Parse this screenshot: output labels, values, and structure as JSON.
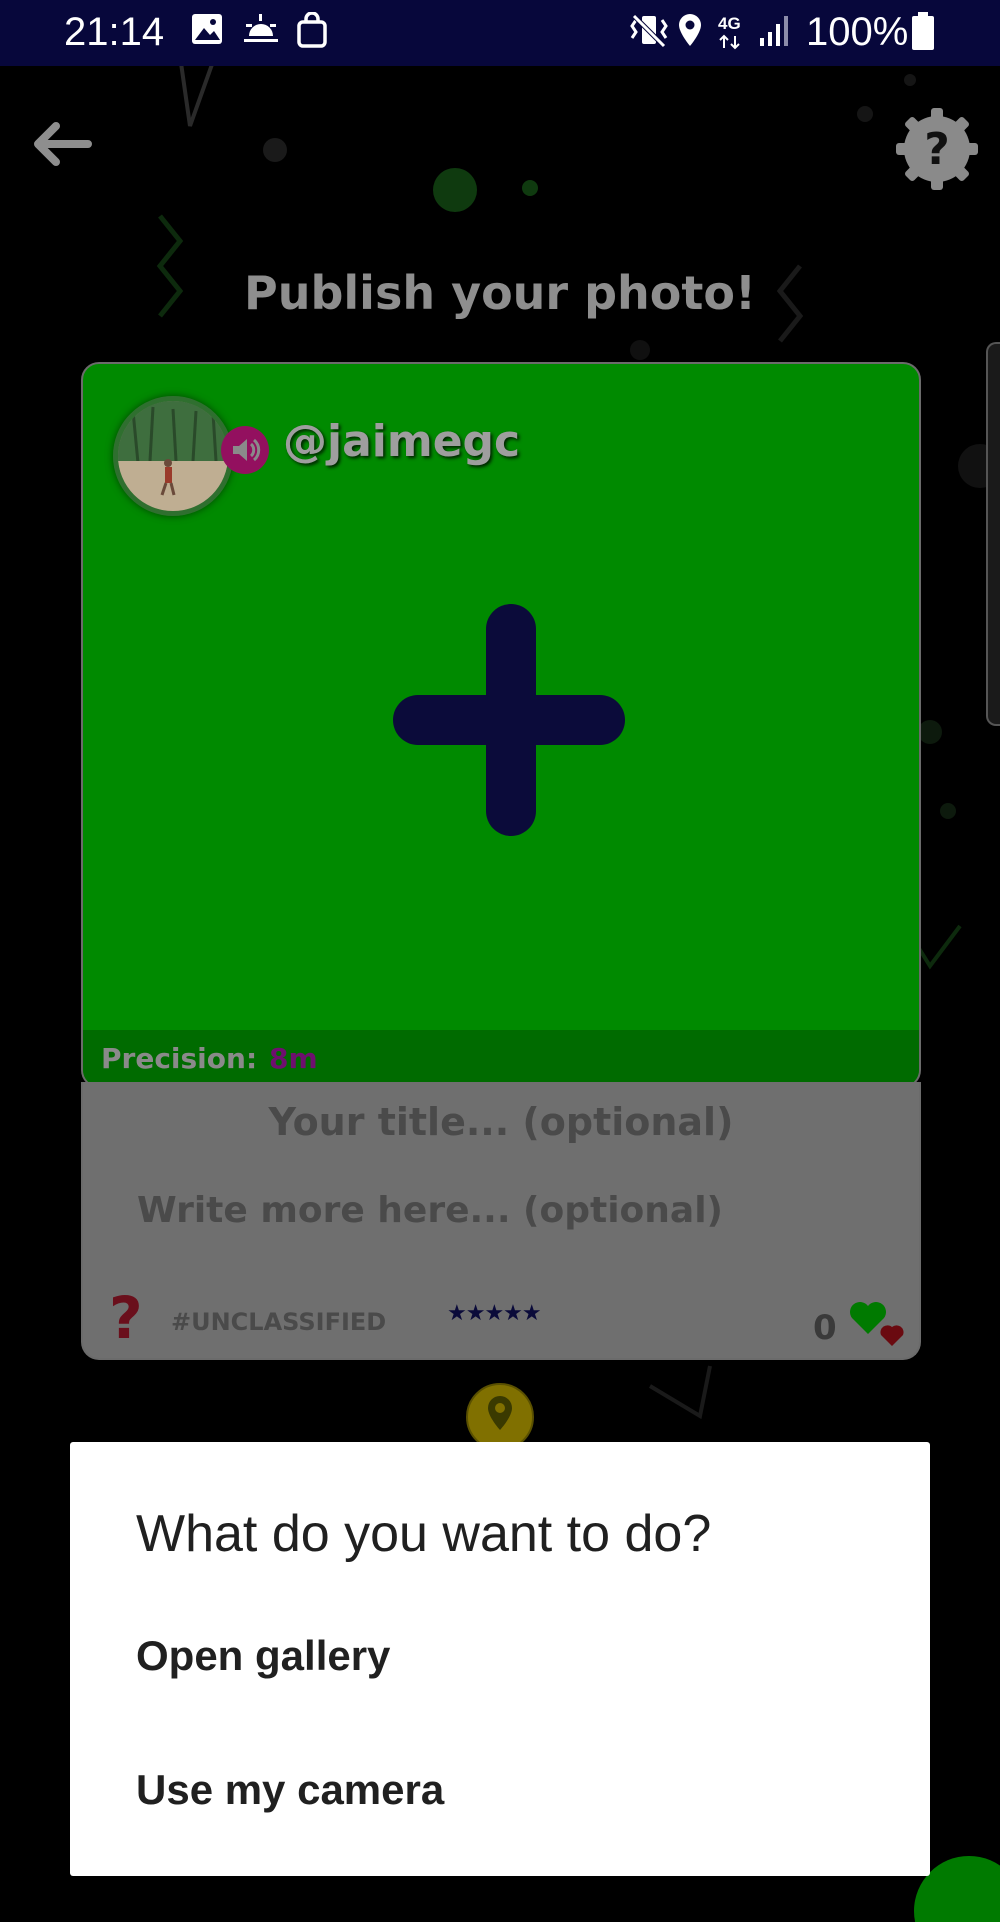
{
  "status_bar": {
    "time": "21:14",
    "battery": "100%",
    "network": "4G",
    "icons": [
      "image-icon",
      "sunrise-icon",
      "shopping-bag-icon",
      "vibrate-icon",
      "location-icon",
      "signal-icon",
      "battery-icon"
    ]
  },
  "header": {
    "title": "Publish your photo!",
    "back_icon": "arrow-left-icon",
    "help_icon": "gear-help-icon"
  },
  "post": {
    "username": "@jaimegc",
    "precision_label": "Precision:",
    "precision_value": "8m",
    "title_placeholder": "Your title... (optional)",
    "description_placeholder": "Write more here... (optional)",
    "category": "#UNCLASSIFIED",
    "rating_stars": "★★★★★",
    "likes": "0"
  },
  "dialog": {
    "title": "What do you want to do?",
    "options": [
      "Open gallery",
      "Use my camera"
    ]
  },
  "colors": {
    "status_bar": "#07073b",
    "photo_area": "#008a00",
    "precision_bar": "#006b00",
    "plus": "#0b0b3a",
    "dialog_bg": "#ffffff"
  }
}
